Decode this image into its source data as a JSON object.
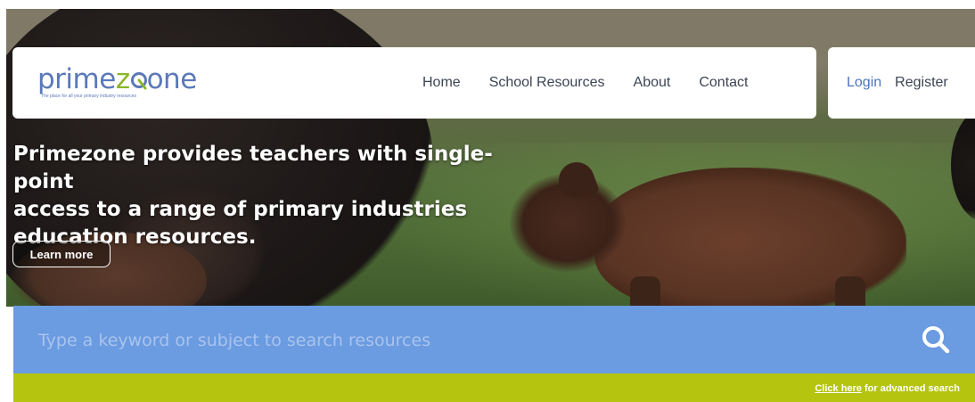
{
  "brand": {
    "logo_prefix": "prime",
    "logo_accent": "z",
    "logo_accent_color": "#8ab628",
    "logo_main_color": "#5b79b8",
    "logo_suffix": "one",
    "tagline": "The place for all your primary industry resources"
  },
  "nav": {
    "items": [
      {
        "label": "Home"
      },
      {
        "label": "School Resources"
      },
      {
        "label": "About"
      },
      {
        "label": "Contact"
      }
    ]
  },
  "auth": {
    "login_label": "Login",
    "register_label": "Register",
    "login_color": "#4c73b8"
  },
  "hero": {
    "line1": "Primezone provides teachers with single-point",
    "line2": "access to a range of primary industries",
    "line3": "education resources.",
    "cta_label": "Learn more"
  },
  "search": {
    "placeholder": "Type a keyword or subject to search resources",
    "icon": "search-icon",
    "bar_color": "#6b9be0"
  },
  "advanced": {
    "link_label": "Click here",
    "suffix": " for advanced search",
    "strip_color": "#b5c40f"
  }
}
